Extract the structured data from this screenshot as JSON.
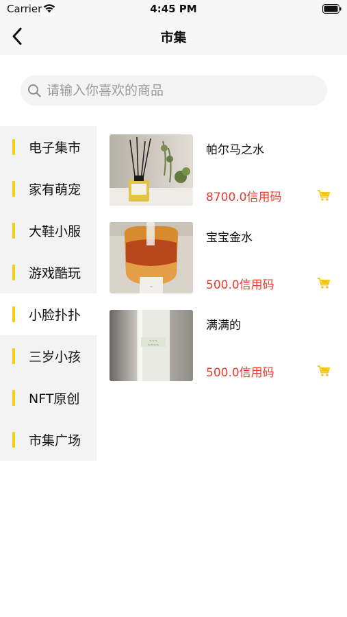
{
  "status_bar": {
    "carrier": "Carrier",
    "time": "4:45 PM"
  },
  "nav": {
    "title": "市集",
    "back_icon": "chevron-left-icon"
  },
  "search": {
    "placeholder": "请输入你喜欢的商品",
    "value": ""
  },
  "sidebar": {
    "accent_color": "#f5cf13",
    "selected_index": 4,
    "items": [
      {
        "label": "电子集市"
      },
      {
        "label": "家有萌宠"
      },
      {
        "label": "大鞋小服"
      },
      {
        "label": "游戏酷玩"
      },
      {
        "label": "小脸扑扑"
      },
      {
        "label": "三岁小孩"
      },
      {
        "label": "NFT原创"
      },
      {
        "label": "市集广场"
      }
    ]
  },
  "products": [
    {
      "name": "帕尔马之水",
      "price": "8700.0信用码"
    },
    {
      "name": "宝宝金水",
      "price": "500.0信用码"
    },
    {
      "name": "满满的",
      "price": "500.0信用码"
    }
  ],
  "colors": {
    "price": "#e83b2e",
    "cart_icon": "#f5c518"
  }
}
